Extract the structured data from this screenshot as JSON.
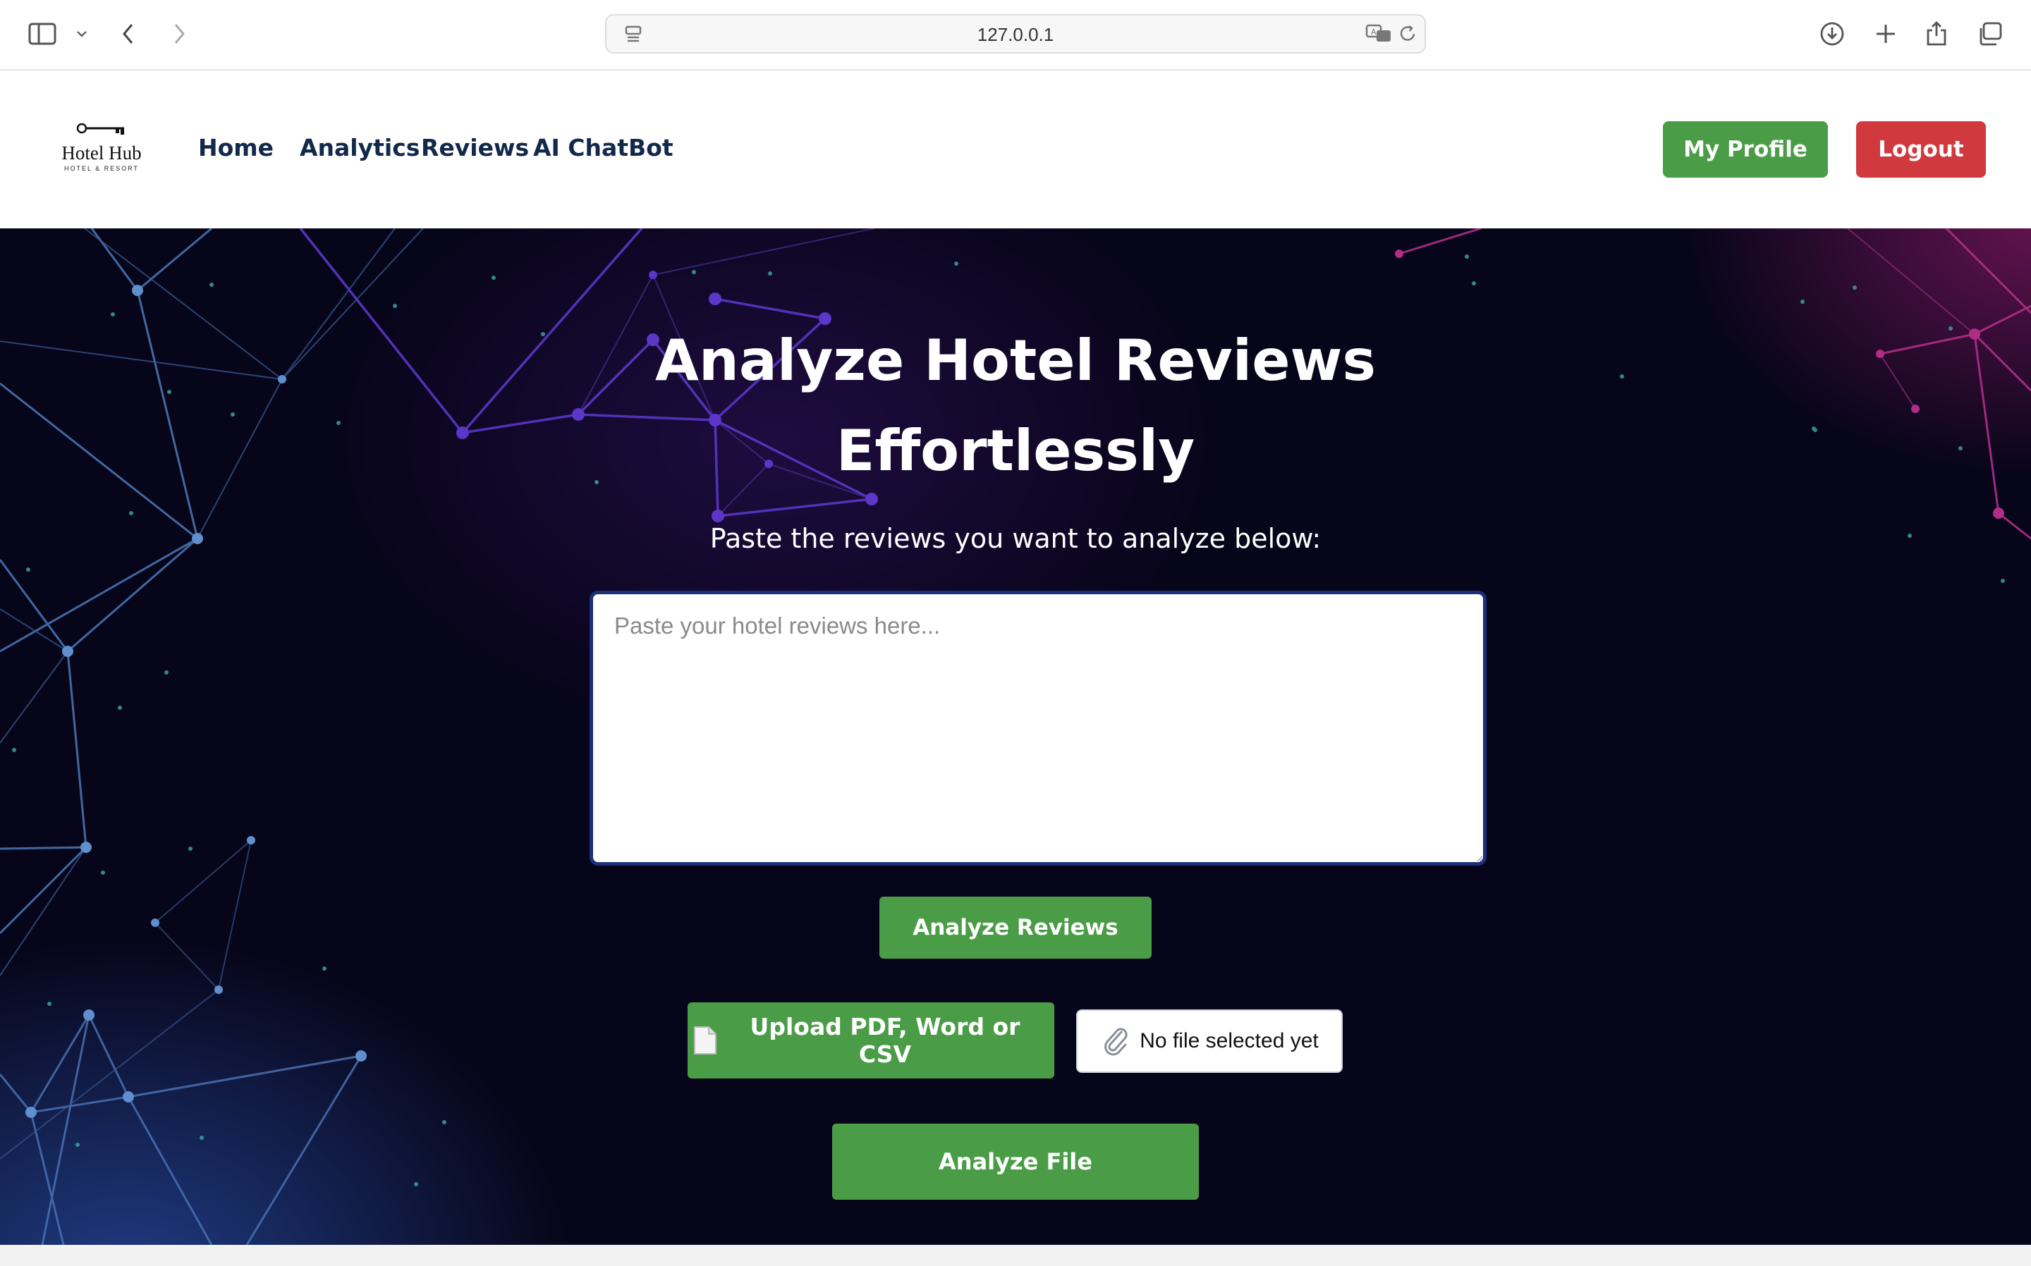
{
  "browser": {
    "url": "127.0.0.1"
  },
  "header": {
    "logo": {
      "name": "Hotel Hub",
      "tagline": "HOTEL & RESORT"
    },
    "nav": [
      {
        "label": "Home"
      },
      {
        "label": "Analytics"
      },
      {
        "label": "Reviews"
      },
      {
        "label": "AI ChatBot"
      }
    ],
    "profile_label": "My Profile",
    "logout_label": "Logout"
  },
  "hero": {
    "title_line1": "Analyze Hotel Reviews",
    "title_line2": "Effortlessly",
    "subtitle": "Paste the reviews you want to analyze below:",
    "textarea_placeholder": "Paste your hotel reviews here...",
    "textarea_value": "",
    "analyze_reviews_label": "Analyze Reviews",
    "upload_label": "Upload PDF, Word or CSV",
    "file_status": "No file selected yet",
    "analyze_file_label": "Analyze File"
  },
  "colors": {
    "accent_green": "#4a9d46",
    "logout_red": "#d0393e",
    "nav_text": "#13294b",
    "hero_bg": "#07051a"
  }
}
